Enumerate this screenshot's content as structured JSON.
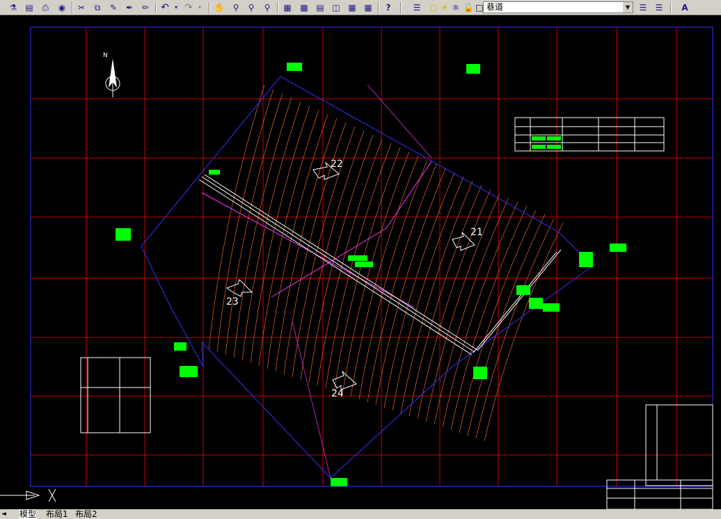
{
  "toolbar": {
    "icons": [
      "publish-icon",
      "plot-preview-icon",
      "plot-icon",
      "web-icon",
      "cut-icon",
      "copy-icon",
      "paste-icon",
      "brush-icon",
      "match-properties-icon",
      "undo-icon",
      "undo-dropdown-icon",
      "redo-icon",
      "redo-dropdown-icon",
      "pan-icon",
      "zoom-realtime-icon",
      "zoom-window-icon",
      "zoom-previous-icon",
      "properties-icon",
      "design-center-icon",
      "tool-palettes-icon",
      "sheet-set-icon",
      "markup-icon",
      "calculator-icon",
      "help-icon",
      "layer-manager-icon",
      "bulb-icon",
      "sun-icon",
      "freeze-icon",
      "lock-icon",
      "color-icon",
      "layer-previous-icon",
      "layer-state-icon",
      "text-style-icon"
    ],
    "layer_name": "巷道"
  },
  "drawing": {
    "zone_labels": [
      "22",
      "21",
      "23",
      "24"
    ],
    "north_label": "N",
    "tables": [
      "main-legend-table",
      "coordinate-table",
      "title-block-table"
    ]
  },
  "tabs": {
    "model": "模型",
    "layout1": "布局1",
    "layout2": "布局2"
  },
  "colors": {
    "background": "#000000",
    "grid": "#ff0000",
    "contour": "#ff7f3f",
    "boundary": "#3333ff",
    "boundary_pink": "#ff33ff",
    "label_green": "#00ff00"
  }
}
